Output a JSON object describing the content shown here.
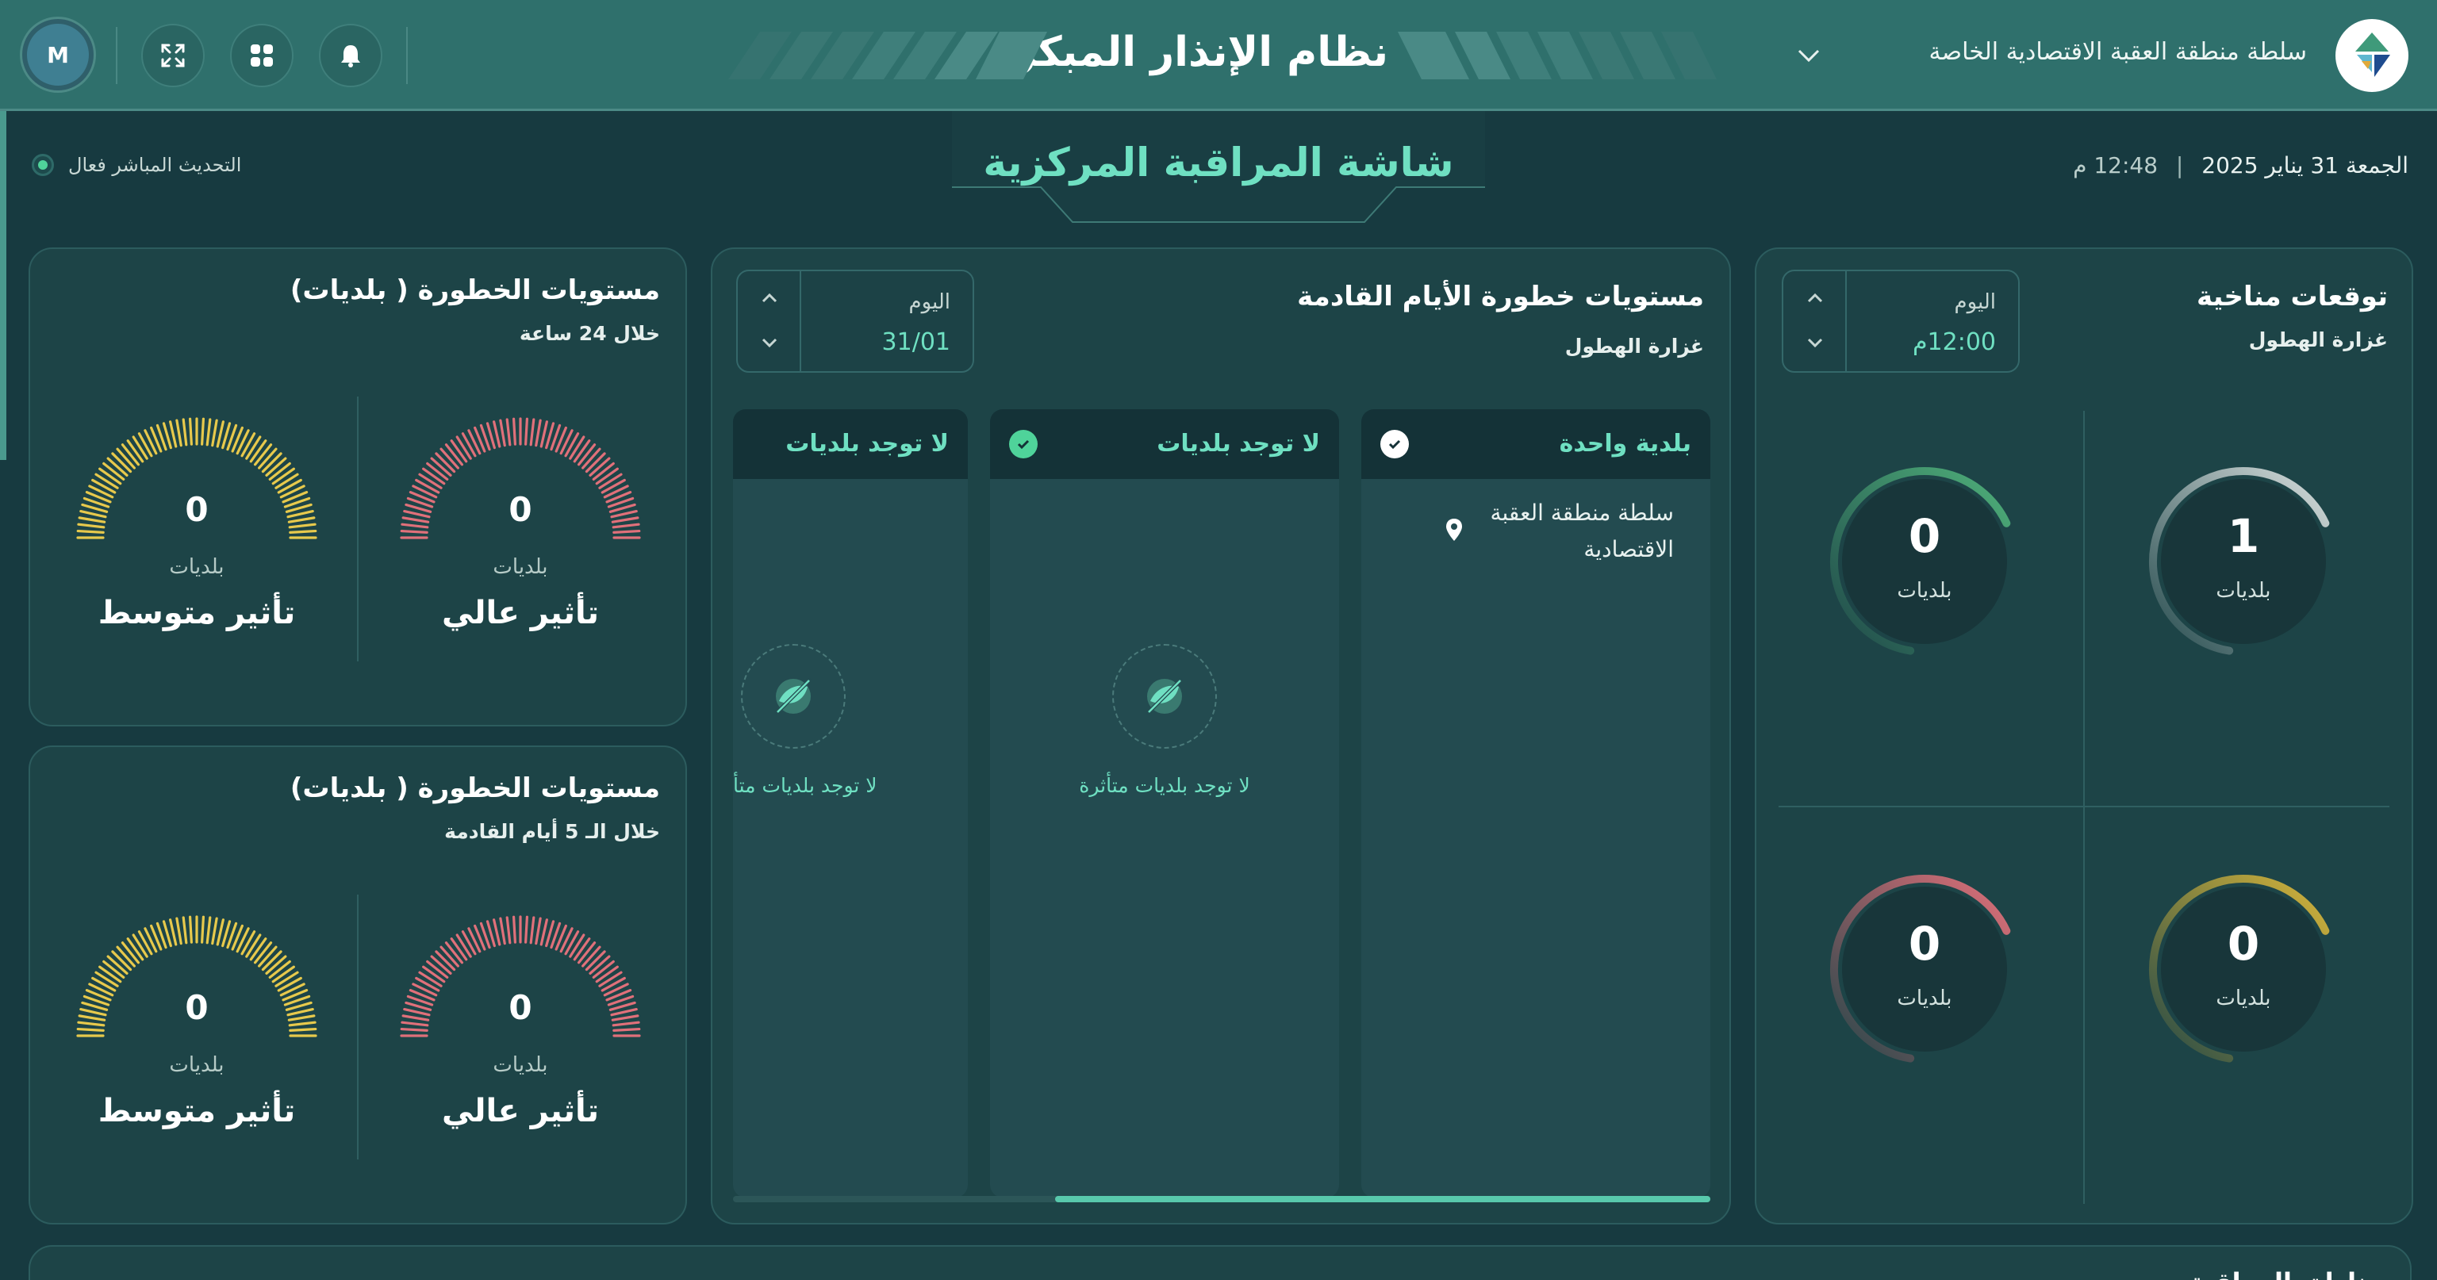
{
  "header": {
    "org_name": "سلطة منطقة العقبة الاقتصادية الخاصة",
    "app_title": "نظام الإنذار المبكر",
    "avatar_initial": "M"
  },
  "subheader": {
    "day": "الجمعة",
    "date": "31 يناير 2025",
    "time": "12:48 م",
    "page_title": "شاشة المراقبة المركزية",
    "live_status": "التحديث المباشر فعال",
    "live_color": "#4fd39a"
  },
  "severity_24h": {
    "title": "مستويات الخطورة ( بلديات)",
    "subtitle": "خلال 24 ساعة",
    "high": {
      "value": "0",
      "unit": "بلديات",
      "label": "تأثير عالي",
      "color": "#e0707a"
    },
    "medium": {
      "value": "0",
      "unit": "بلديات",
      "label": "تأثير متوسط",
      "color": "#e7c94c"
    }
  },
  "severity_5d": {
    "title": "مستويات الخطورة ( بلديات)",
    "subtitle": "خلال الـ 5 أيام القادمة",
    "high": {
      "value": "0",
      "unit": "بلديات",
      "label": "تأثير عالي",
      "color": "#e0707a"
    },
    "medium": {
      "value": "0",
      "unit": "بلديات",
      "label": "تأثير متوسط",
      "color": "#e7c94c"
    }
  },
  "forecast": {
    "title": "مستويات خطورة الأيام القادمة",
    "subtitle": "غزارة الهطول",
    "day_label": "اليوم",
    "day_value": "31/01",
    "columns": [
      {
        "title": "بلدية واحدة",
        "check_style": "white",
        "items": [
          "سلطة منطقة العقبة الاقتصادية"
        ]
      },
      {
        "title": "لا توجد بلديات",
        "check_style": "green",
        "empty_text": "لا توجد بلديات متأثرة"
      },
      {
        "title": "لا توجد بلديات",
        "empty_text": "لا توجد بلديات متأ"
      }
    ]
  },
  "weather": {
    "title": "توقعات مناخية",
    "subtitle": "غزارة الهطول",
    "day_label": "اليوم",
    "time_value": "12:00م",
    "gauges": [
      {
        "value": "1",
        "unit": "بلديات",
        "color": "#d7dedd"
      },
      {
        "value": "0",
        "unit": "بلديات",
        "color": "#4fb07a"
      },
      {
        "value": "0",
        "unit": "بلديات",
        "color": "#d6b53a"
      },
      {
        "value": "0",
        "unit": "بلديات",
        "color": "#e0707a"
      }
    ]
  },
  "bottom": {
    "title": "مناطق المراقبة"
  }
}
